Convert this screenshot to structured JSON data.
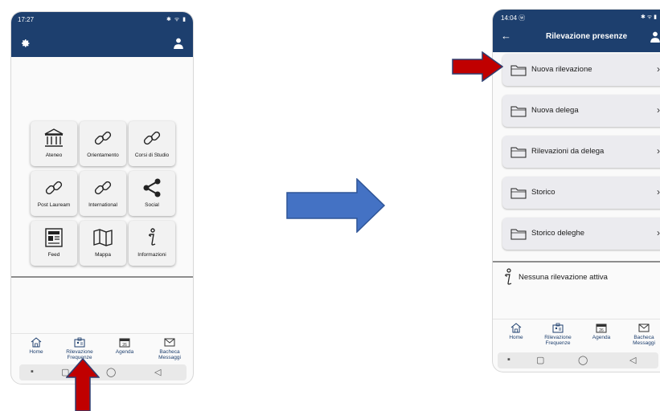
{
  "left_phone": {
    "status_time": "17:27",
    "status_icons": "✱ ᯤ ▮",
    "grid": [
      {
        "label": "Ateneo",
        "icon": "building-icon"
      },
      {
        "label": "Orientamento",
        "icon": "link-icon"
      },
      {
        "label": "Corsi di Studio",
        "icon": "link-icon"
      },
      {
        "label": "Post Lauream",
        "icon": "link-icon"
      },
      {
        "label": "International",
        "icon": "link-icon"
      },
      {
        "label": "Social",
        "icon": "share-icon"
      },
      {
        "label": "Feed",
        "icon": "news-icon"
      },
      {
        "label": "Mappa",
        "icon": "map-icon"
      },
      {
        "label": "Informazioni",
        "icon": "info-icon"
      }
    ],
    "nav": [
      {
        "label": "Home",
        "icon": "home-icon"
      },
      {
        "label": "Rilevazione Frequenze",
        "icon": "id-card-icon"
      },
      {
        "label": "Agenda",
        "icon": "calendar-icon"
      },
      {
        "label": "Bacheca Messaggi",
        "icon": "mail-icon"
      }
    ],
    "system_nav": [
      "▪",
      "▢",
      "◯",
      "◁"
    ]
  },
  "right_phone": {
    "status_time": "14:04 ⓦ",
    "status_icons": "✱ ᯤ ▮",
    "title": "Rilevazione presenze",
    "menu": [
      {
        "label": "Nuova rilevazione"
      },
      {
        "label": "Nuova delega"
      },
      {
        "label": "Rilevazioni da delega"
      },
      {
        "label": "Storico"
      },
      {
        "label": "Storico deleghe"
      }
    ],
    "info_label": "Nessuna rilevazione attiva",
    "nav": [
      {
        "label": "Home",
        "icon": "home-icon"
      },
      {
        "label": "Rilevazione Frequenze",
        "icon": "id-card-icon"
      },
      {
        "label": "Agenda",
        "icon": "calendar-icon"
      },
      {
        "label": "Bacheca Messaggi",
        "icon": "mail-icon"
      }
    ],
    "system_nav": [
      "▪",
      "▢",
      "◯",
      "◁"
    ]
  },
  "colors": {
    "header": "#1d3f6e",
    "arrow_blue": "#4472c4",
    "arrow_red": "#c00000"
  }
}
